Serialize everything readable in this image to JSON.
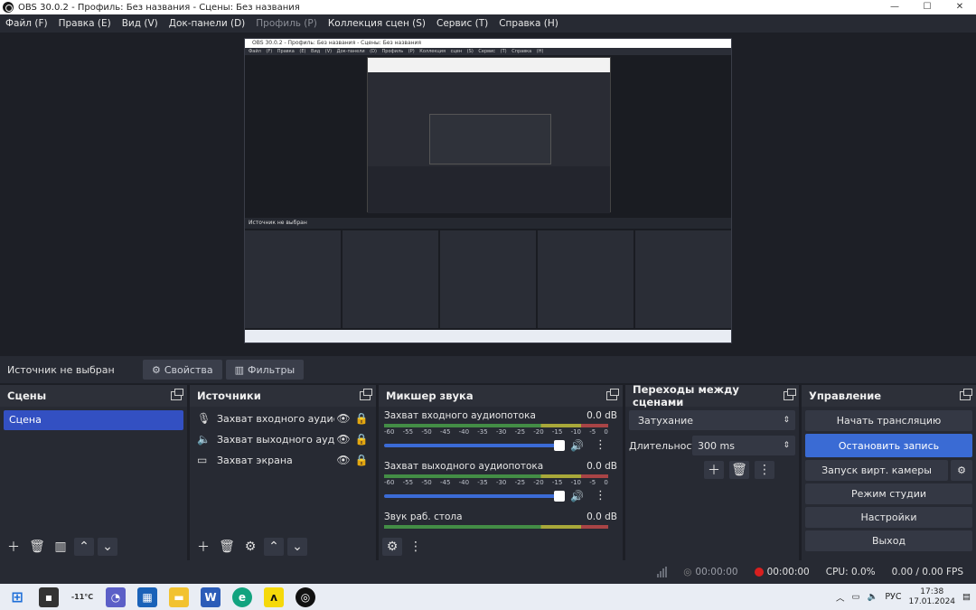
{
  "window": {
    "title": "OBS 30.0.2 - Профиль: Без названия - Сцены: Без названия",
    "minimize": "—",
    "maximize": "☐",
    "close": "✕"
  },
  "menu": {
    "file": "Файл (F)",
    "edit": "Правка (E)",
    "view": "Вид (V)",
    "docks": "Док-панели (D)",
    "profile": "Профиль (P)",
    "scene_collection": "Коллекция сцен (S)",
    "tools": "Сервис (T)",
    "help": "Справка (H)"
  },
  "preview": {
    "nested_title": "OBS 30.0.2 - Профиль: Без названия - Сцены: Без названия",
    "nested_menu": "Файл (F) Правка (E) Вид (V) Док-панели (D) Профиль (P) Коллекция сцен (S) Сервис (T) Справка (H)",
    "nested_source": "Источник не выбран"
  },
  "source_bar": {
    "no_source": "Источник не выбран",
    "properties": "Свойства",
    "filters": "Фильтры"
  },
  "scenes": {
    "title": "Сцены",
    "items": [
      "Сцена"
    ]
  },
  "sources": {
    "title": "Источники",
    "items": [
      {
        "label": "Захват входного аудиопот",
        "icon": "microphone-icon"
      },
      {
        "label": "Захват выходного аудиопо",
        "icon": "speaker-icon"
      },
      {
        "label": "Захват экрана",
        "icon": "monitor-icon"
      }
    ]
  },
  "mixer": {
    "title": "Микшер звука",
    "channels": [
      {
        "name": "Захват входного аудиопотока",
        "db": "0.0 dB",
        "volume": 1.0
      },
      {
        "name": "Захват выходного аудиопотока",
        "db": "0.0 dB",
        "volume": 1.0
      },
      {
        "name": "Звук раб. стола",
        "db": "0.0 dB",
        "volume": 1.0
      }
    ],
    "scale": [
      "-60",
      "-55",
      "-50",
      "-45",
      "-40",
      "-35",
      "-30",
      "-25",
      "-20",
      "-15",
      "-10",
      "-5",
      "0"
    ]
  },
  "transitions": {
    "title": "Переходы между сценами",
    "selected": "Затухание",
    "duration_label": "Длительность",
    "duration_value": "300 ms"
  },
  "controls": {
    "title": "Управление",
    "start_stream": "Начать трансляцию",
    "stop_record": "Остановить запись",
    "virtual_cam": "Запуск вирт. камеры",
    "studio_mode": "Режим студии",
    "settings": "Настройки",
    "exit": "Выход"
  },
  "status": {
    "stream_time": "00:00:00",
    "record_time": "00:00:00",
    "cpu": "CPU: 0.0%",
    "fps": "0.00 / 0.00 FPS"
  },
  "taskbar": {
    "temperature": "-11°C",
    "language": "РУС",
    "time": "17:38",
    "date": "17.01.2024"
  },
  "colors": {
    "accent": "#3a6bd4",
    "scene_selected": "#3350c2",
    "record_dot": "#d81f1f",
    "panel_bg": "#272a33"
  }
}
